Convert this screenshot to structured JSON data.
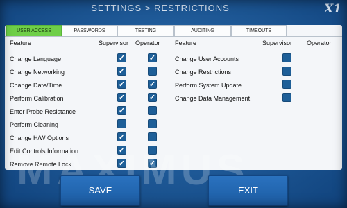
{
  "header": {
    "title": "SETTINGS > RESTRICTIONS",
    "logo": "X1"
  },
  "tabs": [
    {
      "label": "USER ACCESS",
      "active": true
    },
    {
      "label": "PASSWORDS",
      "active": false
    },
    {
      "label": "TESTING",
      "active": false
    },
    {
      "label": "AUDITING",
      "active": false
    },
    {
      "label": "TIMEOUTS",
      "active": false
    }
  ],
  "columns": {
    "feature": "Feature",
    "supervisor": "Supervisor",
    "operator": "Operator"
  },
  "left_features": [
    {
      "label": "Change Language",
      "supervisor": true,
      "operator": true
    },
    {
      "label": "Change Networking",
      "supervisor": true,
      "operator": false
    },
    {
      "label": "Change Date/Time",
      "supervisor": true,
      "operator": true
    },
    {
      "label": "Perform Calibration",
      "supervisor": true,
      "operator": true
    },
    {
      "label": "Enter Probe Resistance",
      "supervisor": true,
      "operator": false
    },
    {
      "label": "Perform Cleaning",
      "supervisor": false,
      "operator": false
    },
    {
      "label": "Change H/W Options",
      "supervisor": true,
      "operator": false
    },
    {
      "label": "Edit Controls Information",
      "supervisor": true,
      "operator": false
    },
    {
      "label": "Remove Remote Lock",
      "supervisor": true,
      "operator": true
    }
  ],
  "right_features": [
    {
      "label": "Change User Accounts",
      "supervisor": false
    },
    {
      "label": "Change Restrictions",
      "supervisor": false
    },
    {
      "label": "Perform System Update",
      "supervisor": false
    },
    {
      "label": "Change Data Management",
      "supervisor": false
    }
  ],
  "watermark": "MAXIMUS",
  "buttons": {
    "save": "SAVE",
    "exit": "EXIT"
  },
  "colors": {
    "background": "#1f5a98",
    "active_tab": "#6fcf48",
    "checkbox": "#1e5f98",
    "button": "#2268b3"
  }
}
